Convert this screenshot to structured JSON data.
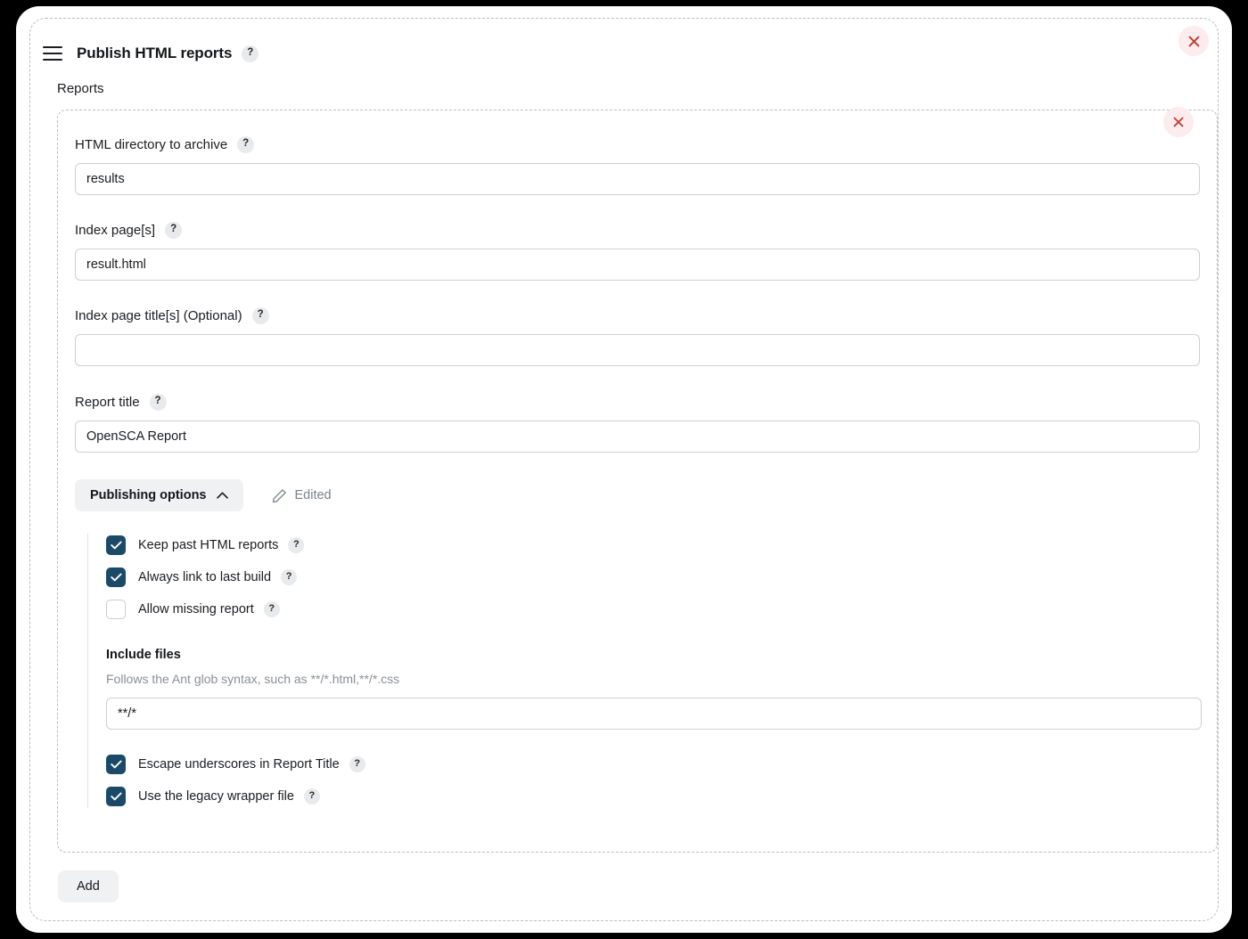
{
  "window": {
    "title": "Publish HTML reports",
    "menu_icon": "hamburger-icon",
    "title_help": "?",
    "close_icon": "close-icon"
  },
  "section": {
    "heading": "Reports",
    "close_icon": "close-icon"
  },
  "fields": [
    {
      "label": "HTML directory to archive",
      "help": "?",
      "value": "results",
      "placeholder": ""
    },
    {
      "label": "Index page[s]",
      "help": "?",
      "value": "result.html",
      "placeholder": ""
    },
    {
      "label": "Index page title[s] (Optional)",
      "help": "?",
      "value": "",
      "placeholder": ""
    },
    {
      "label": "Report title",
      "help": "?",
      "value": "OpenSCA Report",
      "placeholder": ""
    }
  ],
  "publishing": {
    "toggle_label": "Publishing options",
    "chevron_icon": "chevron-up-icon",
    "edited_icon": "pencil-icon",
    "edited_label": "Edited",
    "checkboxes_top": [
      {
        "label": "Keep past HTML reports",
        "checked": true,
        "help": "?"
      },
      {
        "label": "Always link to last build",
        "checked": true,
        "help": "?"
      },
      {
        "label": "Allow missing report",
        "checked": false,
        "help": "?"
      }
    ],
    "include_files": {
      "title": "Include files",
      "hint": "Follows the Ant glob syntax, such as **/*.html,**/*.css",
      "value": "**/*",
      "placeholder": ""
    },
    "checkboxes_bottom": [
      {
        "label": "Escape underscores in Report Title",
        "checked": true,
        "help": "?"
      },
      {
        "label": "Use the legacy wrapper file",
        "checked": true,
        "help": "?"
      }
    ]
  },
  "footer": {
    "add_label": "Add"
  },
  "colors": {
    "checkbox_on": "#1b4a68",
    "close_bg": "#fdeced",
    "close_fg": "#c0392f",
    "pill_bg": "#f0f1f3"
  }
}
